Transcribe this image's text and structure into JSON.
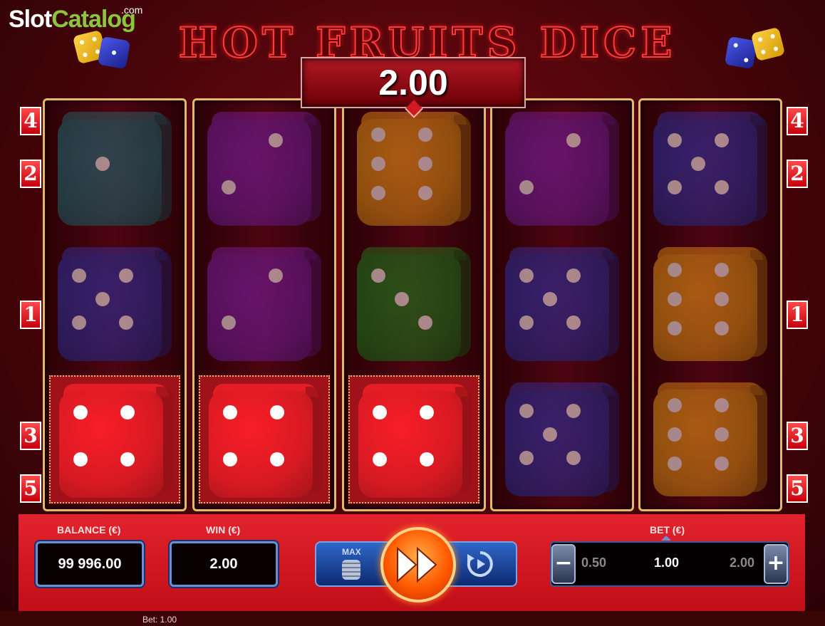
{
  "watermark": {
    "part1": "Slot",
    "part2": "Catalog",
    "part3": ".com"
  },
  "game_title": "HOT FRUITS DICE",
  "last_win": "2.00",
  "line_numbers": {
    "left": [
      "4",
      "2",
      "1",
      "3",
      "5"
    ],
    "right": [
      "4",
      "2",
      "1",
      "3",
      "5"
    ]
  },
  "reels": [
    [
      {
        "color": "#1e5b63",
        "pips": 1,
        "win": false
      },
      {
        "color": "#2b2a8a",
        "pips": 5,
        "win": false
      },
      {
        "color": "#d81a22",
        "pips": 4,
        "win": true
      }
    ],
    [
      {
        "color": "#6a1a8c",
        "pips": 2,
        "win": false
      },
      {
        "color": "#6a1a8c",
        "pips": 2,
        "win": false
      },
      {
        "color": "#d81a22",
        "pips": 4,
        "win": true
      }
    ],
    [
      {
        "color": "#c77c12",
        "pips": 6,
        "win": false
      },
      {
        "color": "#1a6b1a",
        "pips": 3,
        "win": false
      },
      {
        "color": "#d81a22",
        "pips": 4,
        "win": true
      }
    ],
    [
      {
        "color": "#6a1a8c",
        "pips": 2,
        "win": false
      },
      {
        "color": "#2b2a8a",
        "pips": 5,
        "win": false
      },
      {
        "color": "#2b2a8a",
        "pips": 5,
        "win": false
      }
    ],
    [
      {
        "color": "#2b2a8a",
        "pips": 5,
        "win": false
      },
      {
        "color": "#c77c12",
        "pips": 6,
        "win": false
      },
      {
        "color": "#c77c12",
        "pips": 6,
        "win": false
      }
    ]
  ],
  "panel": {
    "balance_label": "BALANCE (€)",
    "balance_value": "99 996.00",
    "win_label": "WIN (€)",
    "win_value": "2.00",
    "max_label": "MAX",
    "bet_label": "BET (€)",
    "bet_lower": "0.50",
    "bet_current": "1.00",
    "bet_higher": "2.00",
    "minus": "−",
    "plus": "+"
  },
  "footer": {
    "bet_text": "Bet: 1.00"
  },
  "icons": {
    "spin": "fast-forward-icon",
    "auto": "autoplay-icon",
    "max": "coin-stack-icon"
  }
}
